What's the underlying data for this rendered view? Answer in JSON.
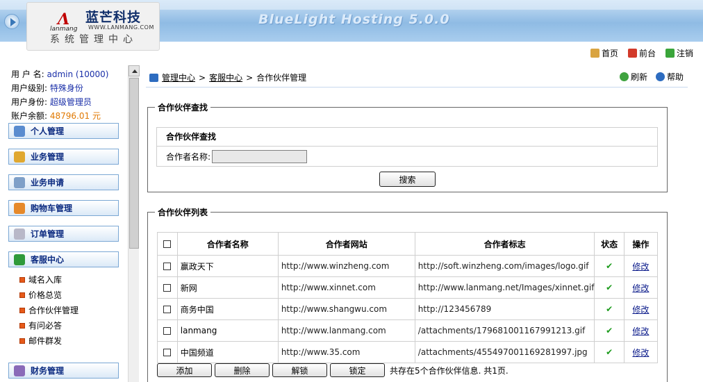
{
  "banner": {
    "title": "BlueLight Hosting 5.0.0",
    "logo_brand": "蓝芒科技",
    "logo_en": "lanmang",
    "logo_url": "WWW.LANMANG.COM",
    "logo_subtitle": "系统管理中心"
  },
  "top_nav": [
    {
      "label": "首页",
      "icon": "home-icon"
    },
    {
      "label": "前台",
      "icon": "frontend-icon"
    },
    {
      "label": "注销",
      "icon": "logout-icon"
    }
  ],
  "user": {
    "name_label": "用 户 名:",
    "name_value": "admin (10000)",
    "level_label": "用户级别:",
    "level_value": "特殊身份",
    "role_label": "用户身份:",
    "role_value": "超级管理员",
    "balance_label": "账户余额:",
    "balance_value": "48796.01 元"
  },
  "sidebar": {
    "menus": [
      {
        "label": "个人管理",
        "icon": "person-icon"
      },
      {
        "label": "业务管理",
        "icon": "box-icon"
      },
      {
        "label": "业务申请",
        "icon": "pen-icon"
      },
      {
        "label": "购物车管理",
        "icon": "cart-icon"
      },
      {
        "label": "订单管理",
        "icon": "order-icon"
      },
      {
        "label": "客服中心",
        "icon": "service-icon"
      },
      {
        "label": "财务管理",
        "icon": "finance-icon"
      }
    ],
    "service_items": [
      "域名入库",
      "价格总览",
      "合作伙伴管理",
      "有问必答",
      "邮件群发"
    ]
  },
  "breadcrumb": {
    "level1": "管理中心",
    "sep": ">",
    "level2": "客服中心",
    "current": "合作伙伴管理",
    "refresh": "刷新",
    "help": "帮助"
  },
  "search": {
    "legend": "合作伙伴查找",
    "header": "合作伙伴查找",
    "field_label": "合作者名称:",
    "field_value": "",
    "button": "搜索"
  },
  "list": {
    "legend": "合作伙伴列表",
    "columns": [
      "合作者名称",
      "合作者网站",
      "合作者标志",
      "状态",
      "操作"
    ],
    "rows": [
      {
        "name": "赢政天下",
        "site": "http://www.winzheng.com",
        "logo": "http://soft.winzheng.com/images/logo.gif",
        "status": "✔",
        "op": "修改"
      },
      {
        "name": "新网",
        "site": "http://www.xinnet.com",
        "logo": "http://www.lanmang.net/Images/xinnet.gif",
        "status": "✔",
        "op": "修改"
      },
      {
        "name": "商务中国",
        "site": "http://www.shangwu.com",
        "logo": "http://123456789",
        "status": "✔",
        "op": "修改"
      },
      {
        "name": "lanmang",
        "site": "http://www.lanmang.com",
        "logo": "/attachments/179681001167991213.gif",
        "status": "✔",
        "op": "修改"
      },
      {
        "name": "中国频道",
        "site": "http://www.35.com",
        "logo": "/attachments/455497001169281997.jpg",
        "status": "✔",
        "op": "修改"
      }
    ],
    "buttons": [
      "添加",
      "删除",
      "解锁",
      "锁定"
    ],
    "summary": "共存在5个合作伙伴信息. 共1页."
  },
  "colors": {
    "accent": "#0b2a80",
    "tick": "#1a9a1a",
    "money": "#e07800"
  }
}
